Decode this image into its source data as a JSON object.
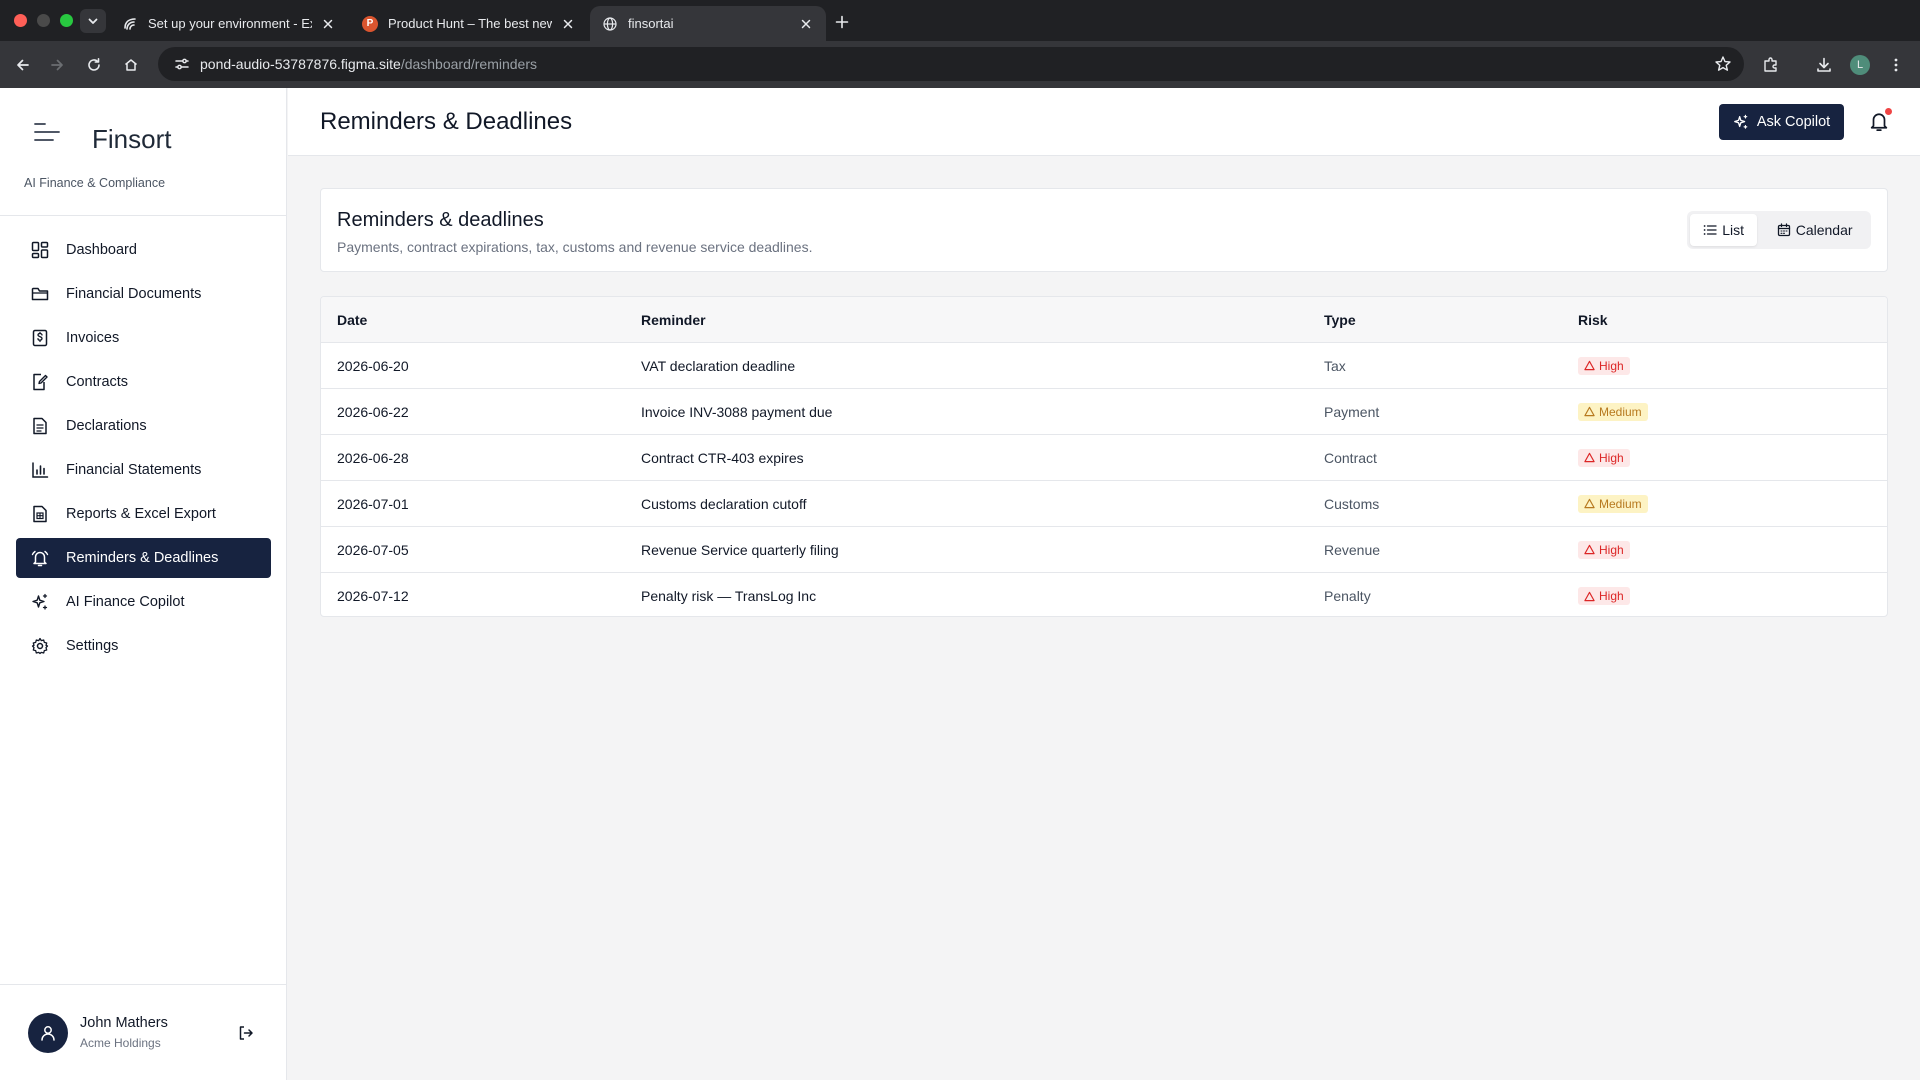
{
  "browser": {
    "tabs": [
      {
        "title": "Set up your environment - Ex",
        "favicon": "gear-logo-icon"
      },
      {
        "title": "Product Hunt – The best new",
        "favicon": "product-hunt-icon",
        "favicon_letter": "P"
      },
      {
        "title": "finsortai",
        "favicon": "globe-icon",
        "active": true
      }
    ],
    "url_host": "pond-audio-53787876.figma.site",
    "url_path": "/dashboard/reminders",
    "profile_letter": "L"
  },
  "brand": {
    "name": "Finsort",
    "tagline": "AI Finance & Compliance"
  },
  "sidebar": {
    "items": [
      {
        "label": "Dashboard",
        "icon": "dashboard-grid-icon"
      },
      {
        "label": "Financial Documents",
        "icon": "folder-icon"
      },
      {
        "label": "Invoices",
        "icon": "invoice-dollar-icon"
      },
      {
        "label": "Contracts",
        "icon": "contract-pen-icon"
      },
      {
        "label": "Declarations",
        "icon": "document-icon"
      },
      {
        "label": "Financial Statements",
        "icon": "bar-chart-icon"
      },
      {
        "label": "Reports & Excel Export",
        "icon": "report-icon"
      },
      {
        "label": "Reminders & Deadlines",
        "icon": "bell-icon",
        "active": true
      },
      {
        "label": "AI Finance Copilot",
        "icon": "sparkles-icon"
      },
      {
        "label": "Settings",
        "icon": "gear-icon"
      }
    ]
  },
  "user": {
    "name": "John Mathers",
    "org": "Acme Holdings"
  },
  "header": {
    "title": "Reminders & Deadlines",
    "ask_label": "Ask Copilot"
  },
  "card": {
    "title": "Reminders & deadlines",
    "subtitle": "Payments, contract expirations, tax, customs and revenue service deadlines.",
    "view_list": "List",
    "view_calendar": "Calendar"
  },
  "table": {
    "headers": {
      "date": "Date",
      "reminder": "Reminder",
      "type": "Type",
      "risk": "Risk"
    },
    "rows": [
      {
        "date": "2026-06-20",
        "reminder": "VAT declaration deadline",
        "type": "Tax",
        "risk": "High"
      },
      {
        "date": "2026-06-22",
        "reminder": "Invoice INV-3088 payment due",
        "type": "Payment",
        "risk": "Medium"
      },
      {
        "date": "2026-06-28",
        "reminder": "Contract CTR-403 expires",
        "type": "Contract",
        "risk": "High"
      },
      {
        "date": "2026-07-01",
        "reminder": "Customs declaration cutoff",
        "type": "Customs",
        "risk": "Medium"
      },
      {
        "date": "2026-07-05",
        "reminder": "Revenue Service quarterly filing",
        "type": "Revenue",
        "risk": "High"
      },
      {
        "date": "2026-07-12",
        "reminder": "Penalty risk — TransLog Inc",
        "type": "Penalty",
        "risk": "High"
      }
    ]
  },
  "colors": {
    "primary": "#172340",
    "high_bg": "#fde8e8",
    "high_fg": "#dc2626",
    "medium_bg": "#fdf3c4",
    "medium_fg": "#b7791f",
    "notification_dot": "#ef4444"
  }
}
